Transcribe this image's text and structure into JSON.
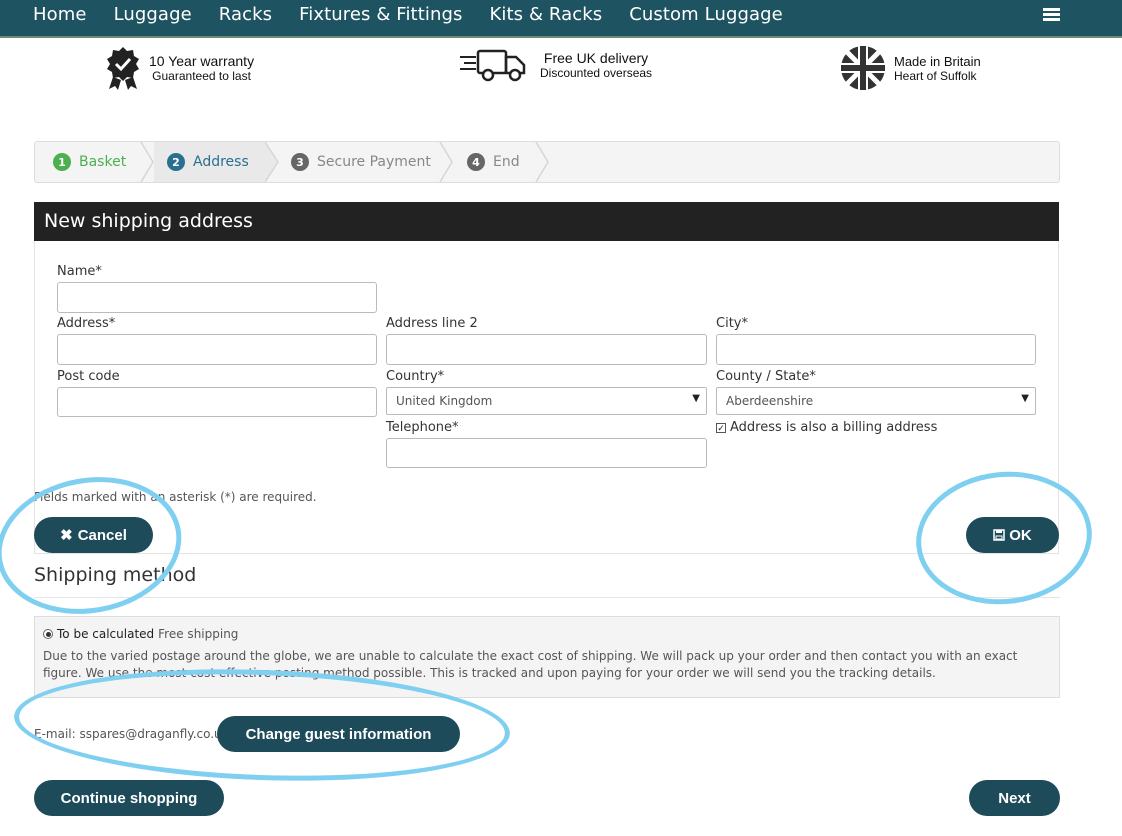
{
  "nav": {
    "items": [
      "Home",
      "Luggage",
      "Racks",
      "Fixtures & Fittings",
      "Kits & Racks",
      "Custom Luggage"
    ]
  },
  "usps": [
    {
      "title": "10 Year warranty",
      "subtitle": "Guaranteed to last",
      "icon": "warranty-badge-icon"
    },
    {
      "title": "Free UK delivery",
      "subtitle": "Discounted overseas",
      "icon": "delivery-truck-icon"
    },
    {
      "title": "Made in Britain",
      "subtitle": "Heart of Suffolk",
      "icon": "union-flag-icon"
    }
  ],
  "steps": [
    {
      "num": "1",
      "label": "Basket",
      "color": "#4caf50"
    },
    {
      "num": "2",
      "label": "Address",
      "color": "#2a6f8f"
    },
    {
      "num": "3",
      "label": "Secure Payment",
      "color": "#666666"
    },
    {
      "num": "4",
      "label": "End",
      "color": "#666666"
    }
  ],
  "form": {
    "title": "New shipping address",
    "name_label": "Name*",
    "address_label": "Address*",
    "address2_label": "Address line 2",
    "city_label": "City*",
    "postcode_label": "Post code",
    "country_label": "Country*",
    "country_value": "United Kingdom",
    "county_label": "County / State*",
    "county_value": "Aberdeenshire",
    "telephone_label": "Telephone*",
    "billing_label": "Address is also a billing address",
    "required_note": "Fields marked with an asterisk (*) are required.",
    "cancel_label": "Cancel",
    "ok_label": "OK"
  },
  "shipping": {
    "title": "Shipping method",
    "option_label": "To be calculated",
    "option_value": "Free shipping",
    "description": "Due to the varied postage around the globe, we are unable to calculate the exact cost of shipping. We will pack up your order and then contact you with an exact figure. We use the most cost effective posting method possible. This is tracked and upon paying for your order we will send you the tracking details."
  },
  "guest": {
    "email_text": "E-mail: sspares@draganfly.co.uk",
    "change_label": "Change guest information"
  },
  "footer": {
    "continue_label": "Continue shopping",
    "next_label": "Next"
  },
  "colors": {
    "nav_bg": "#1e5361",
    "button_bg": "#1d4b5a",
    "highlight_ring": "#7ecff0"
  }
}
